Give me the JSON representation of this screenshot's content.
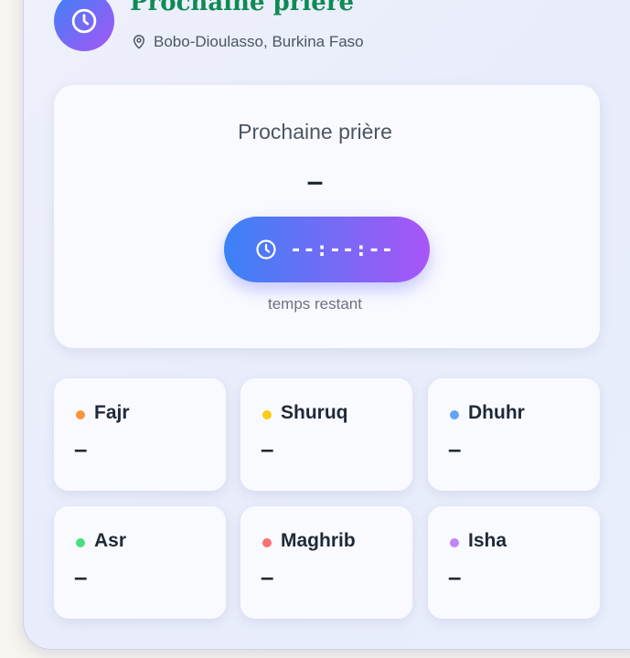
{
  "header": {
    "title": "Prochaine prière",
    "location": "Bobo-Dioulasso, Burkina Faso"
  },
  "next_prayer": {
    "label": "Prochaine prière",
    "name": "–",
    "countdown": "--:--:--",
    "remaining_label": "temps restant"
  },
  "prayers": [
    {
      "name": "Fajr",
      "time": "–",
      "color": "#fb923c"
    },
    {
      "name": "Shuruq",
      "time": "–",
      "color": "#facc15"
    },
    {
      "name": "Dhuhr",
      "time": "–",
      "color": "#60a5fa"
    },
    {
      "name": "Asr",
      "time": "–",
      "color": "#4ade80"
    },
    {
      "name": "Maghrib",
      "time": "–",
      "color": "#f87171"
    },
    {
      "name": "Isha",
      "time": "–",
      "color": "#c084fc"
    }
  ],
  "icons": {
    "header": "clock-icon",
    "location": "map-pin-icon",
    "timer": "clock-icon"
  }
}
